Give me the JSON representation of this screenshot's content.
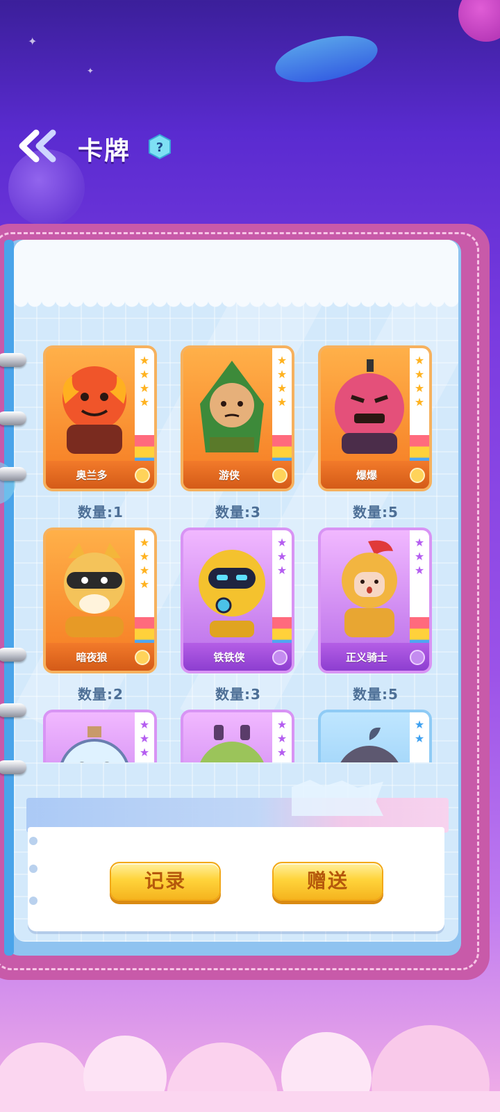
{
  "header": {
    "title": "卡牌",
    "help_glyph": "?"
  },
  "cards": [
    {
      "name": "奥兰多",
      "quantity": "数量:1",
      "rarity": "orange",
      "stars": 4,
      "icon": "flame-warrior-art"
    },
    {
      "name": "游侠",
      "quantity": "数量:3",
      "rarity": "orange",
      "stars": 4,
      "icon": "green-ranger-art"
    },
    {
      "name": "爆爆",
      "quantity": "数量:5",
      "rarity": "orange",
      "stars": 4,
      "icon": "bomb-monster-art"
    },
    {
      "name": "暗夜狼",
      "quantity": "数量:2",
      "rarity": "orange",
      "stars": 4,
      "icon": "night-wolf-art"
    },
    {
      "name": "铁铁侠",
      "quantity": "数量:3",
      "rarity": "purple",
      "stars": 3,
      "icon": "robot-art"
    },
    {
      "name": "正义骑士",
      "quantity": "数量:5",
      "rarity": "purple",
      "stars": 3,
      "icon": "knight-art"
    },
    {
      "name": "",
      "quantity": "",
      "rarity": "purple",
      "stars": 3,
      "icon": "potion-creature-art"
    },
    {
      "name": "",
      "quantity": "",
      "rarity": "purple",
      "stars": 3,
      "icon": "cactus-creature-art"
    },
    {
      "name": "",
      "quantity": "",
      "rarity": "blue",
      "stars": 2,
      "icon": "sprout-creature-art"
    }
  ],
  "actions": {
    "record_label": "记录",
    "gift_label": "赠送"
  },
  "colors": {
    "orange_card": "#f57a22",
    "purple_card": "#b76be8",
    "blue_card": "#7cc0f2",
    "button_gold": "#ffd43b",
    "book_pink": "#c85aa9"
  }
}
